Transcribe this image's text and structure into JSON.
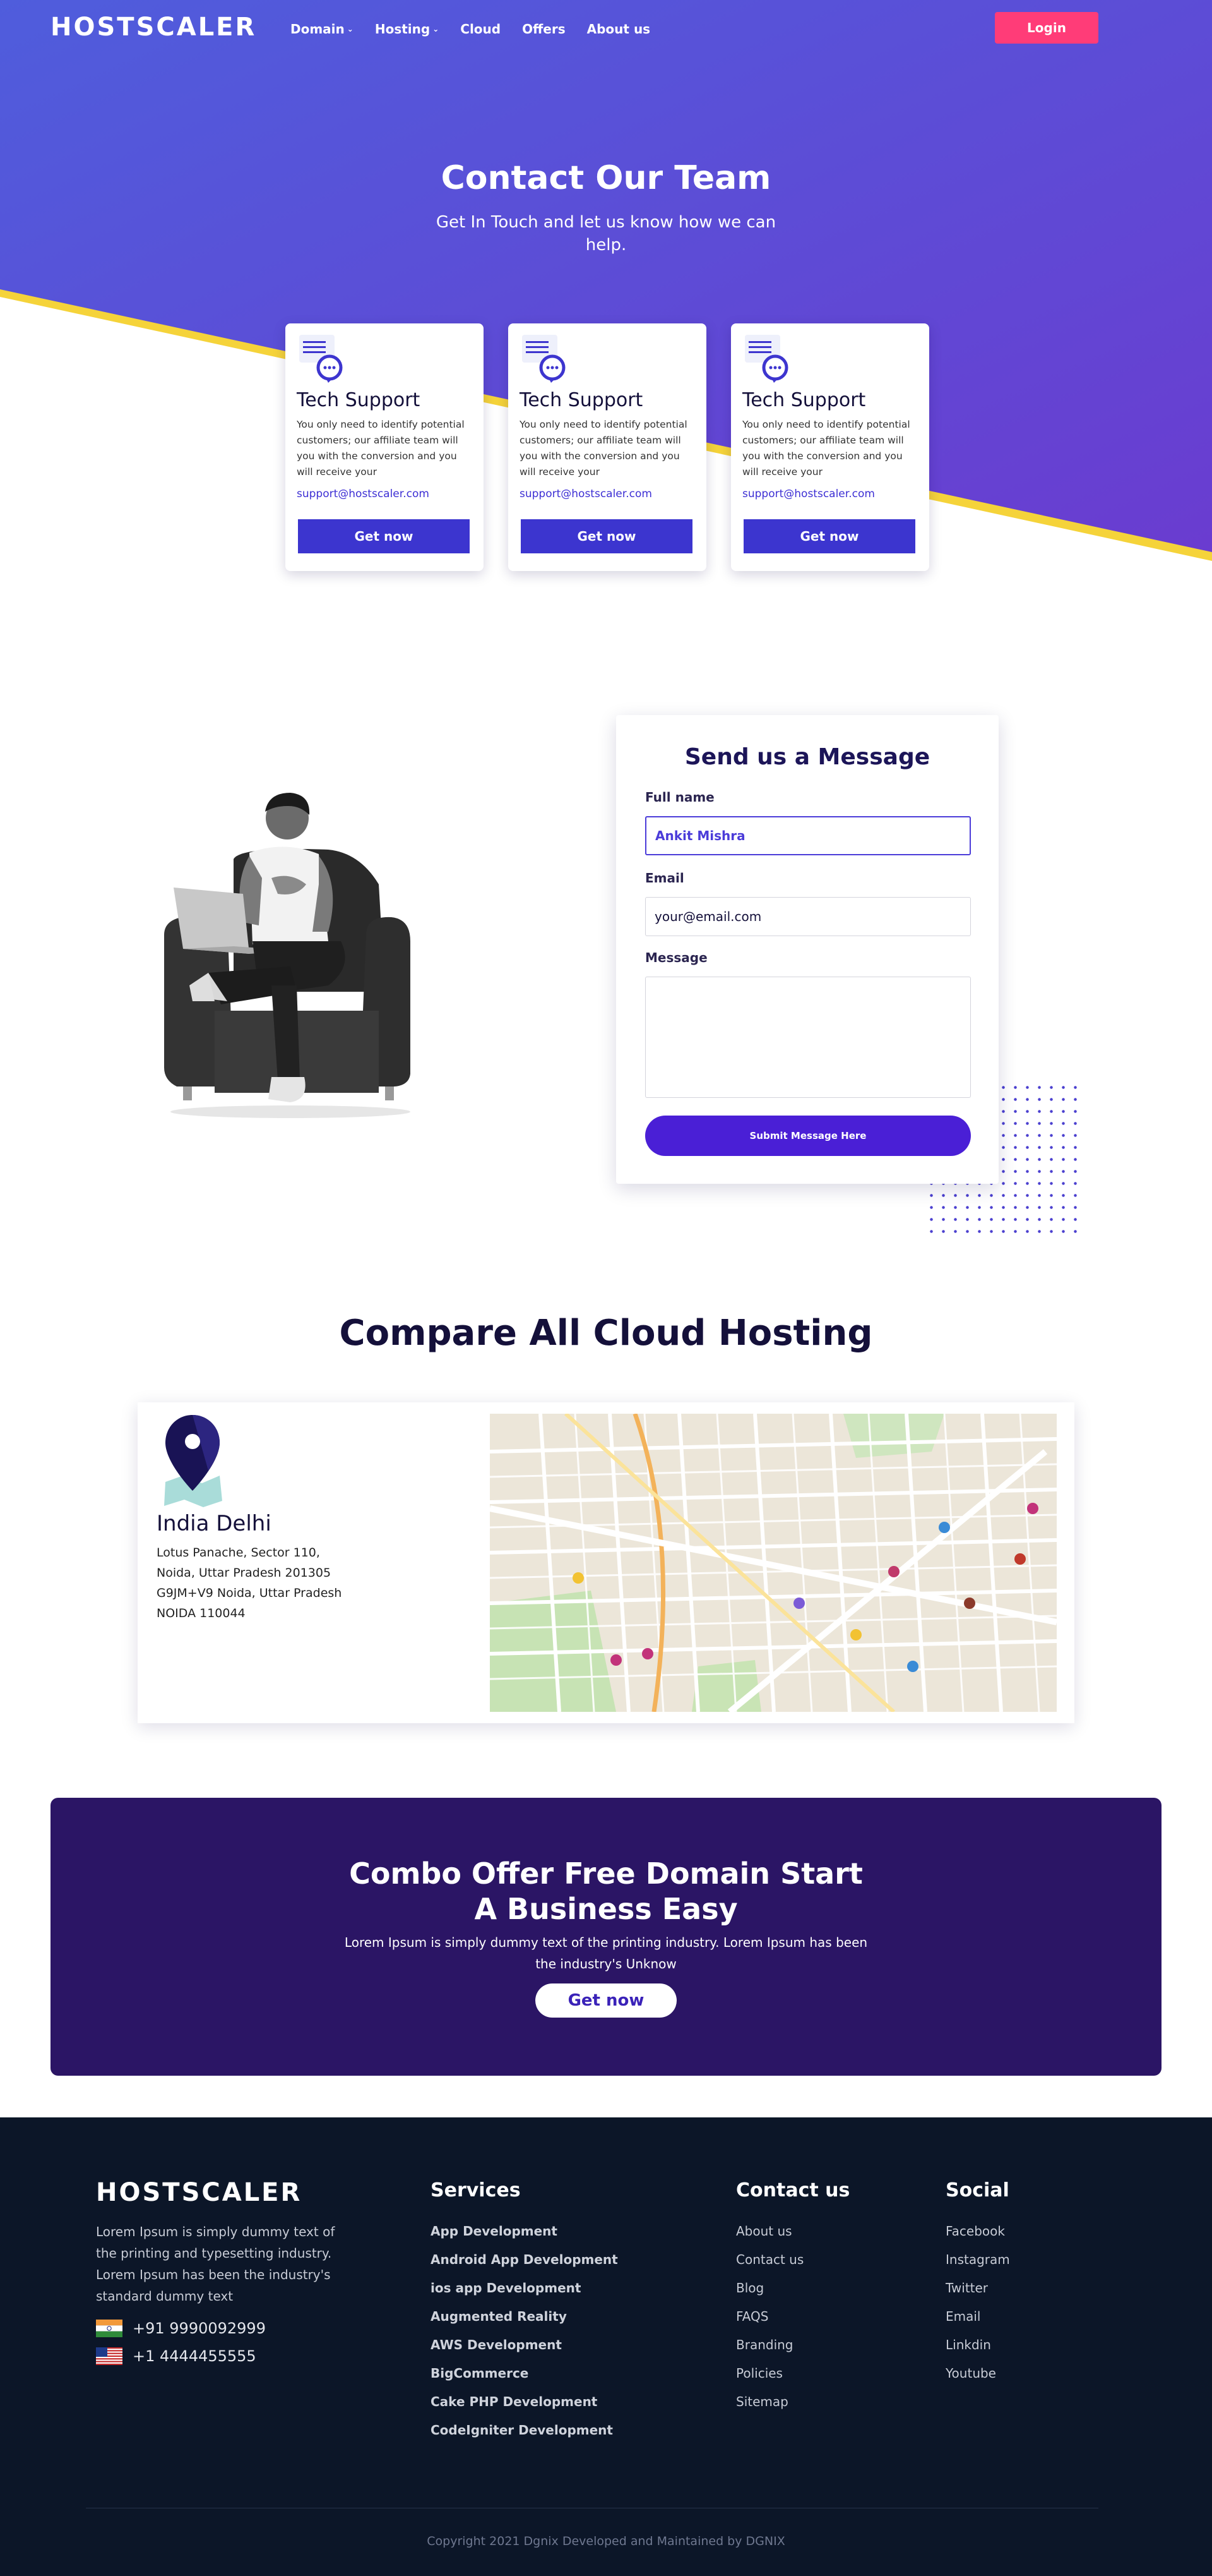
{
  "colors": {
    "hero_gradient_start": "#4f58dc",
    "hero_gradient_end": "#6a3fd0",
    "accent_stripe": "#f5d33a",
    "login": "#ff3c78",
    "primary": "#3c35cf",
    "footer_bg": "#0c1628",
    "combo_bg": "#2b1565"
  },
  "header": {
    "logo": "HOSTSCALER",
    "nav": [
      {
        "label": "Domain",
        "dropdown": true
      },
      {
        "label": "Hosting",
        "dropdown": true
      },
      {
        "label": "Cloud",
        "dropdown": false
      },
      {
        "label": "Offers",
        "dropdown": false
      },
      {
        "label": "About us",
        "dropdown": false
      }
    ],
    "login_label": "Login"
  },
  "hero": {
    "title": "Contact Our Team",
    "subtitle": "Get In Touch and let us know how we can help."
  },
  "support_cards": [
    {
      "icon": "chat-icon",
      "title": "Tech Support",
      "text": "You only need to identify potential customers; our affiliate team will you with the conversion and you will receive your",
      "email": "support@hostscaler.com",
      "button": "Get now"
    },
    {
      "icon": "chat-icon",
      "title": "Tech Support",
      "text": "You only need to identify potential customers; our affiliate team will you with the conversion and you will receive your",
      "email": "support@hostscaler.com",
      "button": "Get now"
    },
    {
      "icon": "chat-icon",
      "title": "Tech Support",
      "text": "You only need to identify potential customers; our affiliate team will you with the conversion and you will receive your",
      "email": "support@hostscaler.com",
      "button": "Get now"
    }
  ],
  "message_form": {
    "title": "Send us a Message",
    "fullname_label": "Full name",
    "fullname_value": "Ankit Mishra",
    "email_label": "Email",
    "email_value": "your@email.com",
    "message_label": "Message",
    "message_value": "",
    "submit_label": "Submit Message Here"
  },
  "compare": {
    "title": "Compare All Cloud Hosting",
    "location_title": "India Delhi",
    "address_lines": [
      "Lotus Panache, Sector 110,",
      "Noida, Uttar Pradesh 201305",
      "G9JM+V9 Noida, Uttar Pradesh",
      "NOIDA 110044"
    ]
  },
  "combo": {
    "title_line1": "Combo Offer Free Domain Start",
    "title_line2": "A Business Easy",
    "text": "Lorem Ipsum is simply dummy text of the printing industry. Lorem Ipsum has been the industry's Unknow",
    "button": "Get now"
  },
  "footer": {
    "logo": "HOSTSCALER",
    "about": "Lorem Ipsum is simply dummy text of the printing and typesetting industry. Lorem Ipsum has been the industry's standard dummy text",
    "phones": [
      {
        "flag": "india-flag-icon",
        "number": "+91 9990092999"
      },
      {
        "flag": "usa-flag-icon",
        "number": "+1 4444455555"
      }
    ],
    "services_title": "Services",
    "services": [
      "App Development",
      "Android App Development",
      "ios app Development",
      "Augmented Reality",
      "AWS Development",
      "BigCommerce",
      "Cake PHP Development",
      "CodeIgniter Development"
    ],
    "contact_title": "Contact us",
    "contact_links": [
      "About us",
      "Contact us",
      "Blog",
      "FAQS",
      "Branding",
      "Policies",
      "Sitemap"
    ],
    "social_title": "Social",
    "social_links": [
      "Facebook",
      "Instagram",
      "Twitter",
      "Email",
      "Linkdin",
      "Youtube"
    ],
    "copyright": "Copyright 2021 Dgnix Developed and Maintained by DGNIX"
  }
}
